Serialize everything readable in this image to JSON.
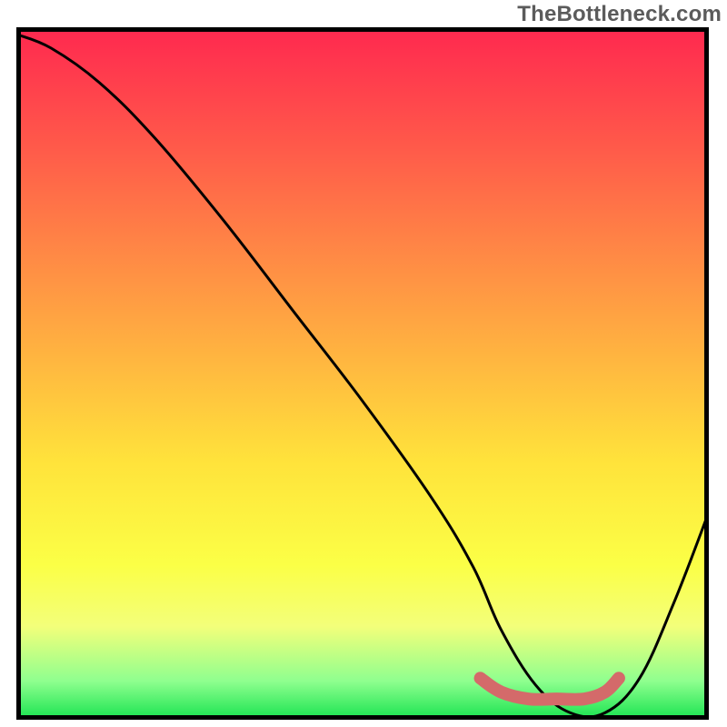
{
  "watermark": "TheBottleneck.com",
  "chart_data": {
    "type": "line",
    "title": "",
    "xlabel": "",
    "ylabel": "",
    "xlim": [
      0,
      100
    ],
    "ylim": [
      0,
      100
    ],
    "series": [
      {
        "name": "main-curve",
        "color": "#000000",
        "x": [
          0,
          5,
          12,
          20,
          30,
          40,
          50,
          60,
          66,
          70,
          75,
          80,
          85,
          90,
          95,
          100
        ],
        "y": [
          99,
          97,
          92,
          84,
          72,
          59,
          46,
          32,
          22,
          13,
          5,
          1,
          1,
          6,
          17,
          30
        ]
      },
      {
        "name": "marker-band",
        "color": "#d46a6a",
        "x": [
          67,
          70,
          74,
          78,
          82,
          85,
          87
        ],
        "y": [
          6,
          4,
          3,
          3,
          3,
          4,
          6
        ]
      }
    ],
    "gradient": {
      "stops": [
        {
          "pos": 0.0,
          "color": "#ff2a4f"
        },
        {
          "pos": 0.17,
          "color": "#ff5a4a"
        },
        {
          "pos": 0.33,
          "color": "#ff8a45"
        },
        {
          "pos": 0.48,
          "color": "#ffb640"
        },
        {
          "pos": 0.63,
          "color": "#ffe33b"
        },
        {
          "pos": 0.78,
          "color": "#fbff46"
        },
        {
          "pos": 0.87,
          "color": "#f3ff7a"
        },
        {
          "pos": 0.95,
          "color": "#8fff8f"
        },
        {
          "pos": 1.0,
          "color": "#26e657"
        }
      ]
    }
  }
}
